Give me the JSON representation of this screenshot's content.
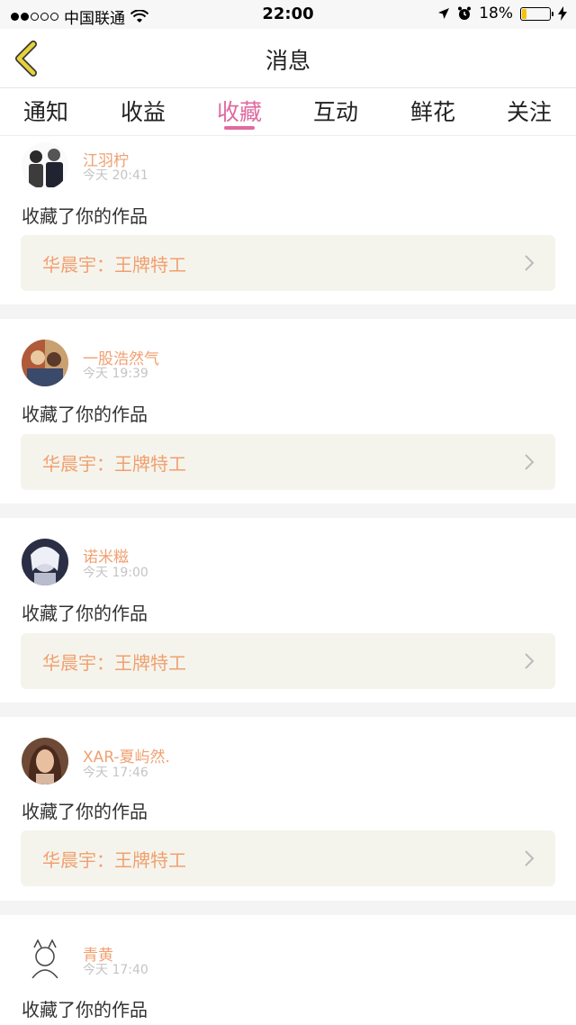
{
  "status_bar": {
    "carrier": "中国联通",
    "time": "22:00",
    "battery": "18%",
    "battery_level": 0.18
  },
  "nav": {
    "title": "消息"
  },
  "tabs": [
    {
      "label": "通知"
    },
    {
      "label": "收益"
    },
    {
      "label": "收藏",
      "active": true
    },
    {
      "label": "互动"
    },
    {
      "label": "鲜花"
    },
    {
      "label": "关注"
    }
  ],
  "feed": [
    {
      "name": "江羽柠",
      "time": "今天 20:41",
      "action": "收藏了你的作品",
      "work": "华晨宇：王牌特工"
    },
    {
      "name": "一股浩然气",
      "time": "今天 19:39",
      "action": "收藏了你的作品",
      "work": "华晨宇：王牌特工"
    },
    {
      "name": "诺米糍",
      "time": "今天 19:00",
      "action": "收藏了你的作品",
      "work": "华晨宇：王牌特工"
    },
    {
      "name": "XAR-夏屿然.",
      "time": "今天 17:46",
      "action": "收藏了你的作品",
      "work": "华晨宇：王牌特工"
    },
    {
      "name": "青黄",
      "time": "今天 17:40",
      "action": "收藏了你的作品"
    }
  ],
  "colors": {
    "accent": "#e06aa0",
    "username": "#f0a070",
    "work_bg": "#f5f4ec",
    "back_icon": "#e8d23a"
  }
}
